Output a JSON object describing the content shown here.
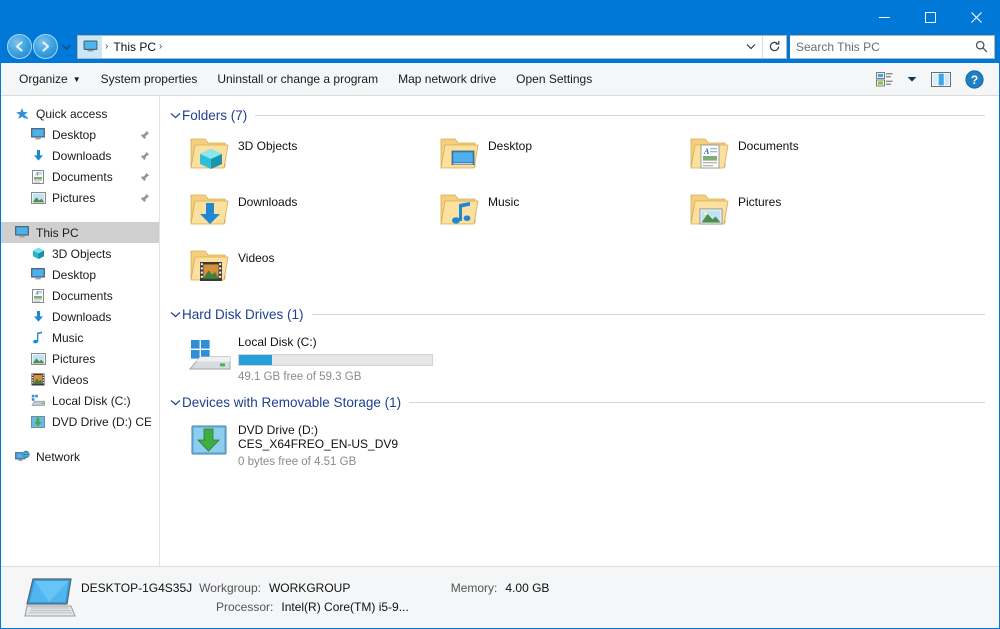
{
  "titlebar": {
    "minimize": "minimize-button",
    "maximize": "maximize-button",
    "close": "close-button"
  },
  "address": {
    "root_icon": "this-pc-icon",
    "crumb": "This PC",
    "separator": "›",
    "dropdown": "⌄",
    "refresh": "↻"
  },
  "search": {
    "placeholder": "Search This PC",
    "value": ""
  },
  "toolbar": {
    "organize": "Organize",
    "organize_caret": "▼",
    "system_properties": "System properties",
    "uninstall": "Uninstall or change a program",
    "map_network_drive": "Map network drive",
    "open_settings": "Open Settings",
    "view_caret": "▼"
  },
  "sidebar": {
    "items": [
      {
        "label": "Quick access",
        "icon": "star-icon",
        "level": 0,
        "pinned": false,
        "selected": false
      },
      {
        "label": "Desktop",
        "icon": "desktop-icon",
        "level": 1,
        "pinned": true,
        "selected": false
      },
      {
        "label": "Downloads",
        "icon": "downloads-icon",
        "level": 1,
        "pinned": true,
        "selected": false
      },
      {
        "label": "Documents",
        "icon": "documents-icon",
        "level": 1,
        "pinned": true,
        "selected": false
      },
      {
        "label": "Pictures",
        "icon": "pictures-icon",
        "level": 1,
        "pinned": true,
        "selected": false
      },
      {
        "label": "This PC",
        "icon": "this-pc-icon",
        "level": 0,
        "pinned": false,
        "selected": true,
        "gap_before": true
      },
      {
        "label": "3D Objects",
        "icon": "3d-objects-icon",
        "level": 1,
        "pinned": false,
        "selected": false
      },
      {
        "label": "Desktop",
        "icon": "desktop-icon",
        "level": 1,
        "pinned": false,
        "selected": false
      },
      {
        "label": "Documents",
        "icon": "documents-icon",
        "level": 1,
        "pinned": false,
        "selected": false
      },
      {
        "label": "Downloads",
        "icon": "downloads-icon",
        "level": 1,
        "pinned": false,
        "selected": false
      },
      {
        "label": "Music",
        "icon": "music-icon",
        "level": 1,
        "pinned": false,
        "selected": false
      },
      {
        "label": "Pictures",
        "icon": "pictures-icon",
        "level": 1,
        "pinned": false,
        "selected": false
      },
      {
        "label": "Videos",
        "icon": "videos-icon",
        "level": 1,
        "pinned": false,
        "selected": false
      },
      {
        "label": "Local Disk (C:)",
        "icon": "local-disk-icon",
        "level": 1,
        "pinned": false,
        "selected": false
      },
      {
        "label": "DVD Drive (D:) CES_X",
        "icon": "dvd-drive-icon",
        "level": 1,
        "pinned": false,
        "selected": false
      },
      {
        "label": "Network",
        "icon": "network-icon",
        "level": 0,
        "pinned": false,
        "selected": false,
        "gap_before": true
      }
    ]
  },
  "groups": [
    {
      "title": "Folders (7)",
      "chevron": "⌄"
    },
    {
      "title": "Hard Disk Drives (1)",
      "chevron": "⌄"
    },
    {
      "title": "Devices with Removable Storage (1)",
      "chevron": "⌄"
    }
  ],
  "folders": [
    {
      "label": "3D Objects",
      "icon": "folder-3d-objects-icon"
    },
    {
      "label": "Desktop",
      "icon": "folder-desktop-icon"
    },
    {
      "label": "Downloads",
      "icon": "folder-downloads-icon"
    },
    {
      "label": "Music",
      "icon": "folder-music-icon"
    },
    {
      "label": "Documents",
      "icon": "folder-documents-icon"
    },
    {
      "label": "Pictures",
      "icon": "folder-pictures-icon"
    },
    {
      "label": "Videos",
      "icon": "folder-videos-icon"
    }
  ],
  "hard_disks": [
    {
      "name": "Local Disk (C:)",
      "icon": "windows-drive-icon",
      "free_text": "49.1 GB free of 59.3 GB",
      "used_percent": 17,
      "bar_color": "#26a0da"
    }
  ],
  "removable": [
    {
      "name": "DVD Drive (D:)",
      "volume": "CES_X64FREO_EN-US_DV9",
      "icon": "dvd-drive-icon",
      "free_text": "0 bytes free of 4.51 GB"
    }
  ],
  "status": {
    "computer_icon": "computer-icon",
    "computer_name": "DESKTOP-1G4S35J",
    "workgroup_label": "Workgroup:",
    "workgroup_value": "WORKGROUP",
    "processor_label": "Processor:",
    "processor_value": "Intel(R) Core(TM) i5-9...",
    "memory_label": "Memory:",
    "memory_value": "4.00 GB"
  },
  "colors": {
    "accent": "#0078d7",
    "group_header": "#1f3f8f",
    "capacity_fill": "#26a0da",
    "selection": "#cfcfcf"
  }
}
